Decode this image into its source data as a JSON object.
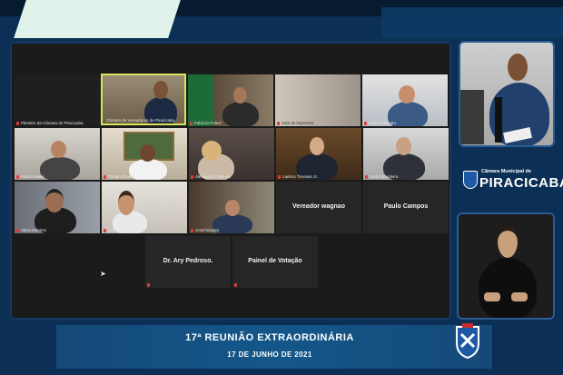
{
  "event": {
    "title": "17ª REUNIÃO EXTRAORDINÁRIA",
    "date": "17 DE JUNHO DE 2021"
  },
  "branding": {
    "small": "Câmara Municipal de",
    "big": "PIRACICABA"
  },
  "gallery": {
    "tiles": [
      {
        "name": "Plenário da Câmara de Piracicaba"
      },
      {
        "name": "Câmara de Vereadores de Piracicaba"
      },
      {
        "name": "Fabricio Polezi"
      },
      {
        "name": "Sala de imprensa"
      },
      {
        "name": "Anilton Rissato"
      },
      {
        "name": "Pedro Kawai"
      },
      {
        "name": "Thiago Ribeiro"
      },
      {
        "name": "Alessandra Bellucci"
      },
      {
        "name": "Laércio Trevisan Jr."
      },
      {
        "name": "André Bandeira"
      },
      {
        "name": "Silvia Morales"
      },
      {
        "name": "Ana Pavão"
      },
      {
        "name": "Josef Borges"
      },
      {
        "name": "Vereador wagnao",
        "label": "Vereador wagnao"
      },
      {
        "name": "Paulo Campos",
        "label": "Paulo Campos"
      },
      {
        "name": "Dr. Ary Pedroso.",
        "label": "Dr. Ary Pedroso."
      },
      {
        "name": "Painel de Votação",
        "label": "Painel de Votação"
      }
    ]
  },
  "colors": {
    "active_border": "#d8e35a",
    "mic_muted": "#e03b3b"
  }
}
